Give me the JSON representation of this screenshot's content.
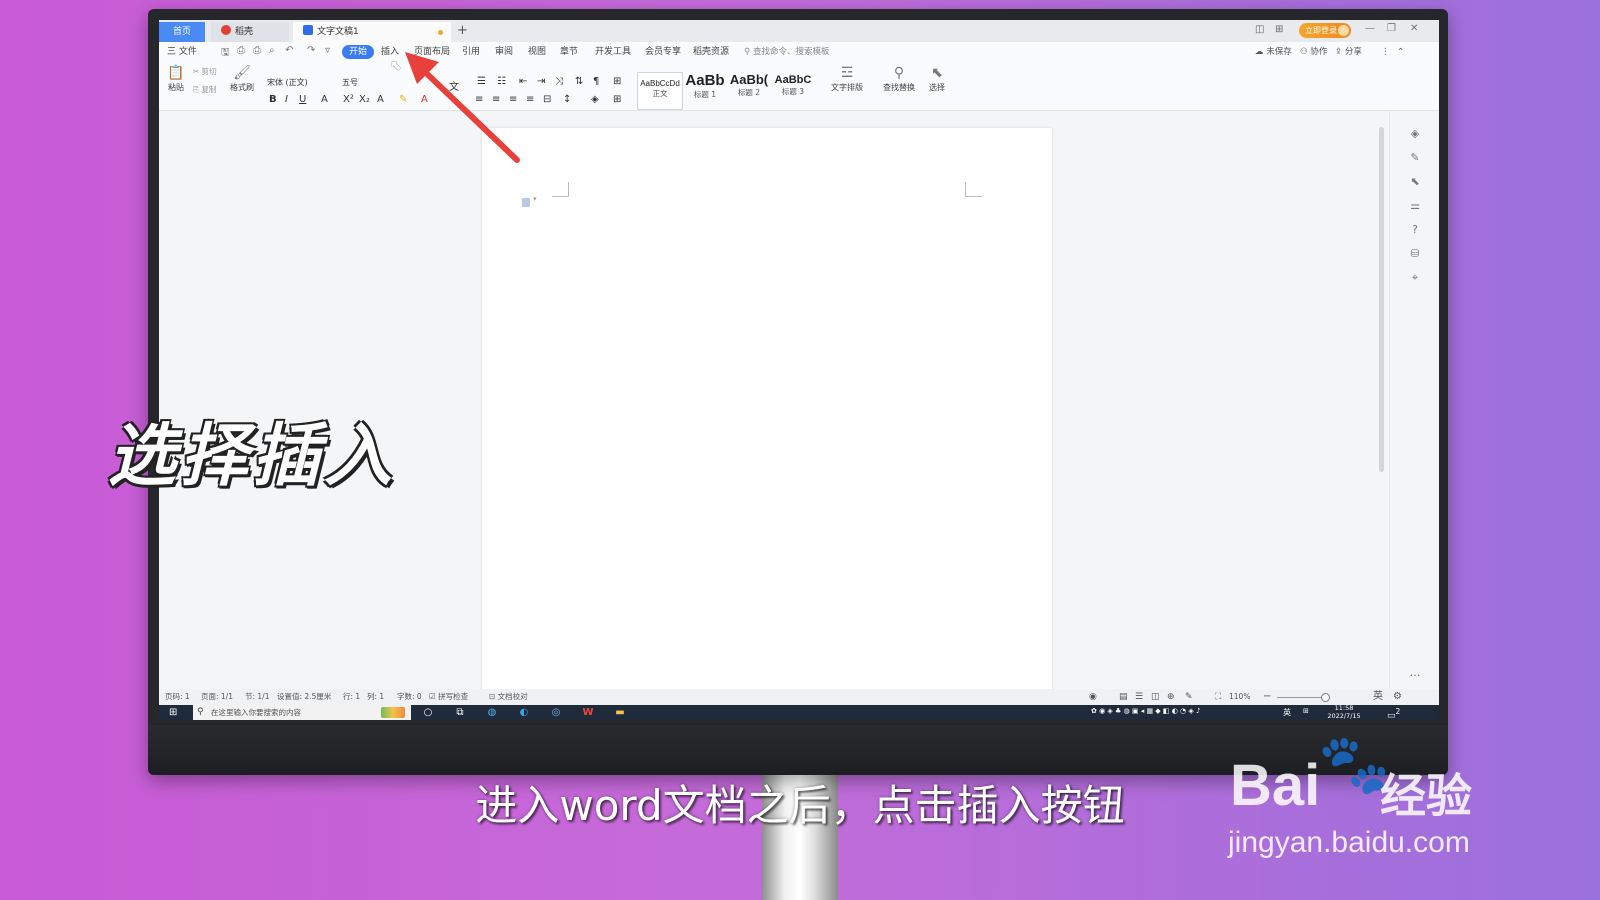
{
  "window": {
    "tabs": [
      {
        "label": "首页"
      },
      {
        "label": "稻壳"
      },
      {
        "label": "文字文稿1"
      }
    ],
    "new_tab_symbol": "+",
    "login_label": "立即登录"
  },
  "menu": {
    "file_label": "三 文件",
    "items": [
      "开始",
      "插入",
      "页面布局",
      "引用",
      "审阅",
      "视图",
      "章节",
      "开发工具",
      "会员专享",
      "稻壳资源"
    ],
    "active_item": "开始",
    "search_placeholder": "查找命令、搜索模板",
    "right_actions": [
      "未保存",
      "协作",
      "分享"
    ]
  },
  "ribbon": {
    "paste_label": "粘贴",
    "cut_label": "剪切",
    "copy_label": "复制",
    "format_painter_label": "格式刷",
    "font_name": "宋体 (正文)",
    "font_size": "五号",
    "styles": [
      {
        "preview": "AaBbCcDd",
        "name": "正文"
      },
      {
        "preview": "AaBb",
        "name": "标题 1"
      },
      {
        "preview": "AaBb(",
        "name": "标题 2"
      },
      {
        "preview": "AaBbC",
        "name": "标题 3"
      }
    ],
    "text_layout_label": "文字排版",
    "find_replace_label": "查找替换",
    "select_label": "选择"
  },
  "status": {
    "page_num": "页码: 1",
    "pages": "页面: 1/1",
    "section": "节: 1/1",
    "setting": "设置值: 2.5厘米",
    "row": "行: 1",
    "col": "列: 1",
    "words": "字数: 0",
    "spellcheck": "拼写检查",
    "proofread": "文档校对",
    "zoom": "110%"
  },
  "taskbar": {
    "search_placeholder": "在这里输入你要搜索的内容",
    "ime": "英",
    "time": "11:58",
    "date": "2022/7/15",
    "notification_count": "2"
  },
  "overlay": {
    "caption": "选择插入",
    "subtitle": "进入word文档之后，点击插入按钮",
    "watermark_brand": "Bai",
    "watermark_cn": "经验",
    "watermark_url": "jingyan.baidu.com"
  },
  "colors": {
    "accent": "#3b7cf4",
    "arrow": "#e8403a",
    "login": "#f29a26"
  }
}
